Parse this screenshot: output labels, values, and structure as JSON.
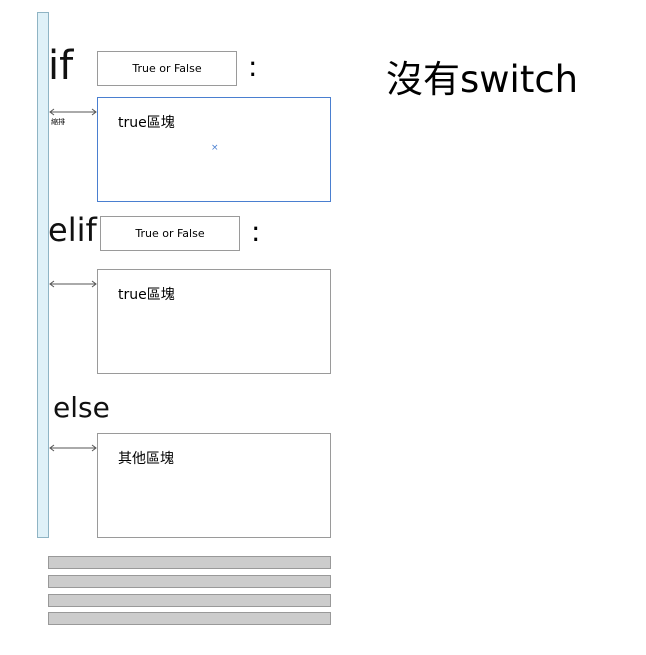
{
  "keywords": {
    "if": "if",
    "elif": "elif",
    "else": "else",
    "colon": ":"
  },
  "conditions": {
    "if": "True or False",
    "elif": "True or False"
  },
  "blocks": {
    "if_body": "true區塊",
    "elif_body": "true區塊",
    "else_body": "其他區塊"
  },
  "indent_label": "縮排",
  "selection_mark": "×",
  "title": "沒有switch",
  "colors": {
    "indent_bar": "#dff1f8",
    "selected_border": "#4a7fd0",
    "bar_fill": "#cccccc"
  }
}
